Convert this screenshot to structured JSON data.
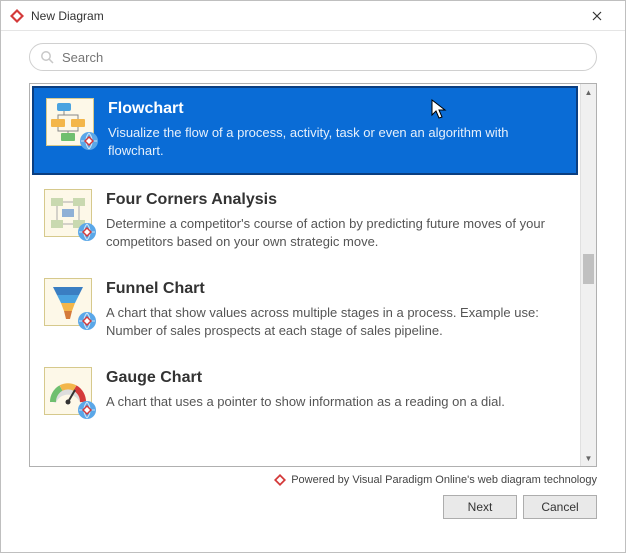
{
  "window": {
    "title": "New Diagram"
  },
  "search": {
    "placeholder": "Search"
  },
  "items": [
    {
      "title": "Flowchart",
      "desc": "Visualize the flow of a process, activity, task or even an algorithm with flowchart."
    },
    {
      "title": "Four Corners Analysis",
      "desc": "Determine a competitor's course of action by predicting future moves of your competitors based on your own strategic move."
    },
    {
      "title": "Funnel Chart",
      "desc": "A chart that show values across multiple stages in a process. Example use: Number of sales prospects at each stage of sales pipeline."
    },
    {
      "title": "Gauge Chart",
      "desc": "A chart that uses a pointer to show information as a reading on a dial."
    }
  ],
  "footer": {
    "powered_by": "Powered by Visual Paradigm Online's web diagram technology",
    "next": "Next",
    "cancel": "Cancel"
  }
}
